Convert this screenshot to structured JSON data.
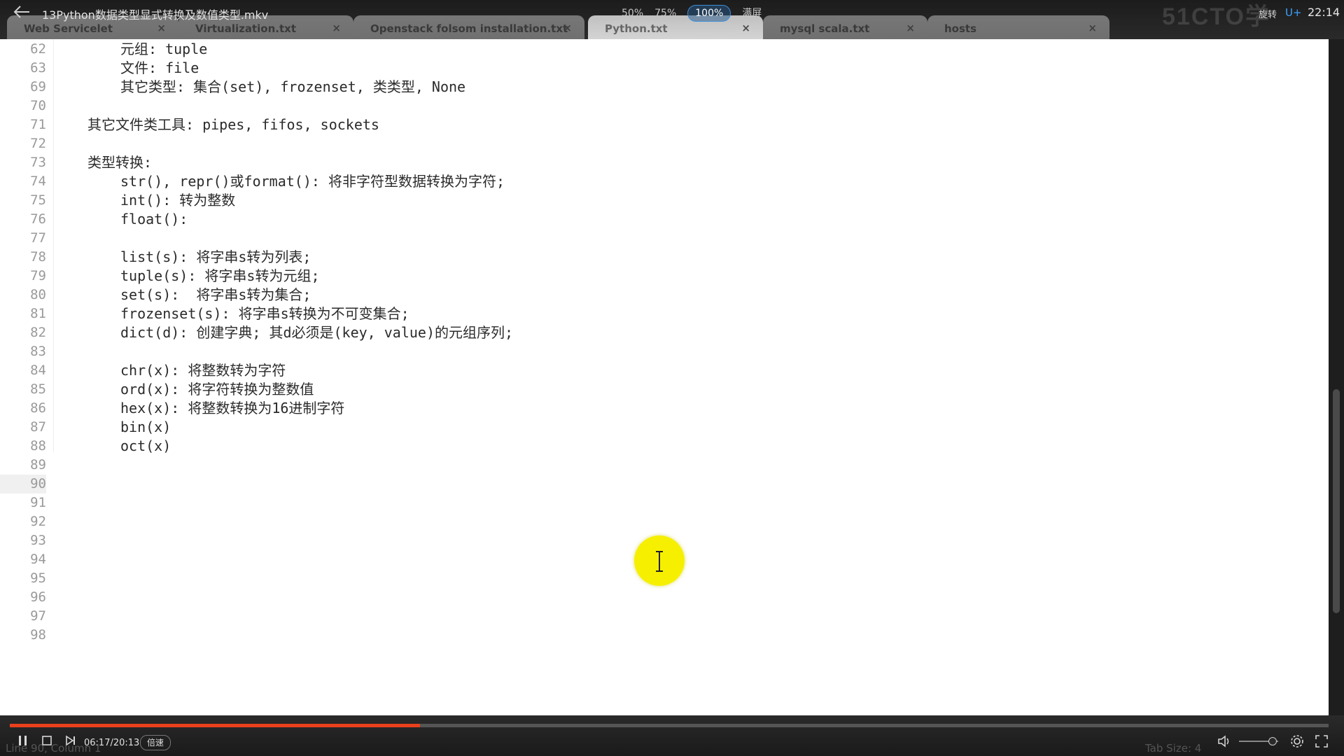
{
  "player": {
    "video_title": "13Python数据类型显式转换及数值类型.mkv",
    "zoom_options": [
      "50%",
      "75%",
      "100%",
      "满屏"
    ],
    "zoom_selected": "100%",
    "rotate_label": "旋转",
    "uplus_label": "U+",
    "clock": "22:14",
    "watermark": "51CTO学",
    "time_readout": "06:17/20:13",
    "speed_label": "倍速",
    "progress_fraction": 0.311
  },
  "editor": {
    "tabs": [
      {
        "label": "Web Servicelet",
        "active": false
      },
      {
        "label": "Virtualization.txt",
        "active": false
      },
      {
        "label": "Openstack folsom installation.txt",
        "active": false
      },
      {
        "label": "Python.txt",
        "active": true
      },
      {
        "label": "mysql scala.txt",
        "active": false
      },
      {
        "label": "hosts",
        "active": false
      }
    ],
    "lines": [
      {
        "n": "62",
        "indent": 2,
        "text": "元组: tuple"
      },
      {
        "n": "63",
        "indent": 2,
        "text": "文件: file"
      },
      {
        "n": "69",
        "indent": 2,
        "text": "其它类型: 集合(set), frozenset, 类类型, None"
      },
      {
        "n": "70",
        "indent": 0,
        "text": ""
      },
      {
        "n": "71",
        "indent": 1,
        "text": "其它文件类工具: pipes, fifos, sockets"
      },
      {
        "n": "72",
        "indent": 0,
        "text": ""
      },
      {
        "n": "73",
        "indent": 1,
        "text": "类型转换:"
      },
      {
        "n": "74",
        "indent": 2,
        "text": "str(), repr()或format(): 将非字符型数据转换为字符;"
      },
      {
        "n": "75",
        "indent": 2,
        "text": "int(): 转为整数"
      },
      {
        "n": "76",
        "indent": 2,
        "text": "float():"
      },
      {
        "n": "77",
        "indent": 0,
        "text": ""
      },
      {
        "n": "78",
        "indent": 2,
        "text": "list(s): 将字串s转为列表;"
      },
      {
        "n": "79",
        "indent": 2,
        "text": "tuple(s): 将字串s转为元组;"
      },
      {
        "n": "80",
        "indent": 2,
        "text": "set(s):  将字串s转为集合;"
      },
      {
        "n": "81",
        "indent": 2,
        "text": "frozenset(s): 将字串s转换为不可变集合;"
      },
      {
        "n": "82",
        "indent": 2,
        "text": "dict(d): 创建字典; 其d必须是(key, value)的元组序列;"
      },
      {
        "n": "83",
        "indent": 0,
        "text": ""
      },
      {
        "n": "84",
        "indent": 2,
        "text": "chr(x): 将整数转为字符"
      },
      {
        "n": "85",
        "indent": 2,
        "text": "ord(x): 将字符转换为整数值"
      },
      {
        "n": "86",
        "indent": 2,
        "text": "hex(x): 将整数转换为16进制字符"
      },
      {
        "n": "87",
        "indent": 2,
        "text": "bin(x)"
      },
      {
        "n": "88",
        "indent": 2,
        "text": "oct(x)"
      },
      {
        "n": "89",
        "indent": 0,
        "text": ""
      },
      {
        "n": "90",
        "indent": 0,
        "text": "",
        "current": true
      },
      {
        "n": "91",
        "indent": 0,
        "text": ""
      },
      {
        "n": "92",
        "indent": 0,
        "text": ""
      },
      {
        "n": "93",
        "indent": 0,
        "text": ""
      },
      {
        "n": "94",
        "indent": 0,
        "text": ""
      },
      {
        "n": "95",
        "indent": 0,
        "text": ""
      },
      {
        "n": "96",
        "indent": 0,
        "text": ""
      },
      {
        "n": "97",
        "indent": 0,
        "text": ""
      },
      {
        "n": "98",
        "indent": 0,
        "text": ""
      }
    ],
    "status_left": "Line 90, Column 1",
    "status_right": "Tab Size: 4"
  },
  "colors": {
    "progress": "#e8401c",
    "cursor_highlight": "#f6f000",
    "zoom_selected_border": "#3e8ed6"
  }
}
